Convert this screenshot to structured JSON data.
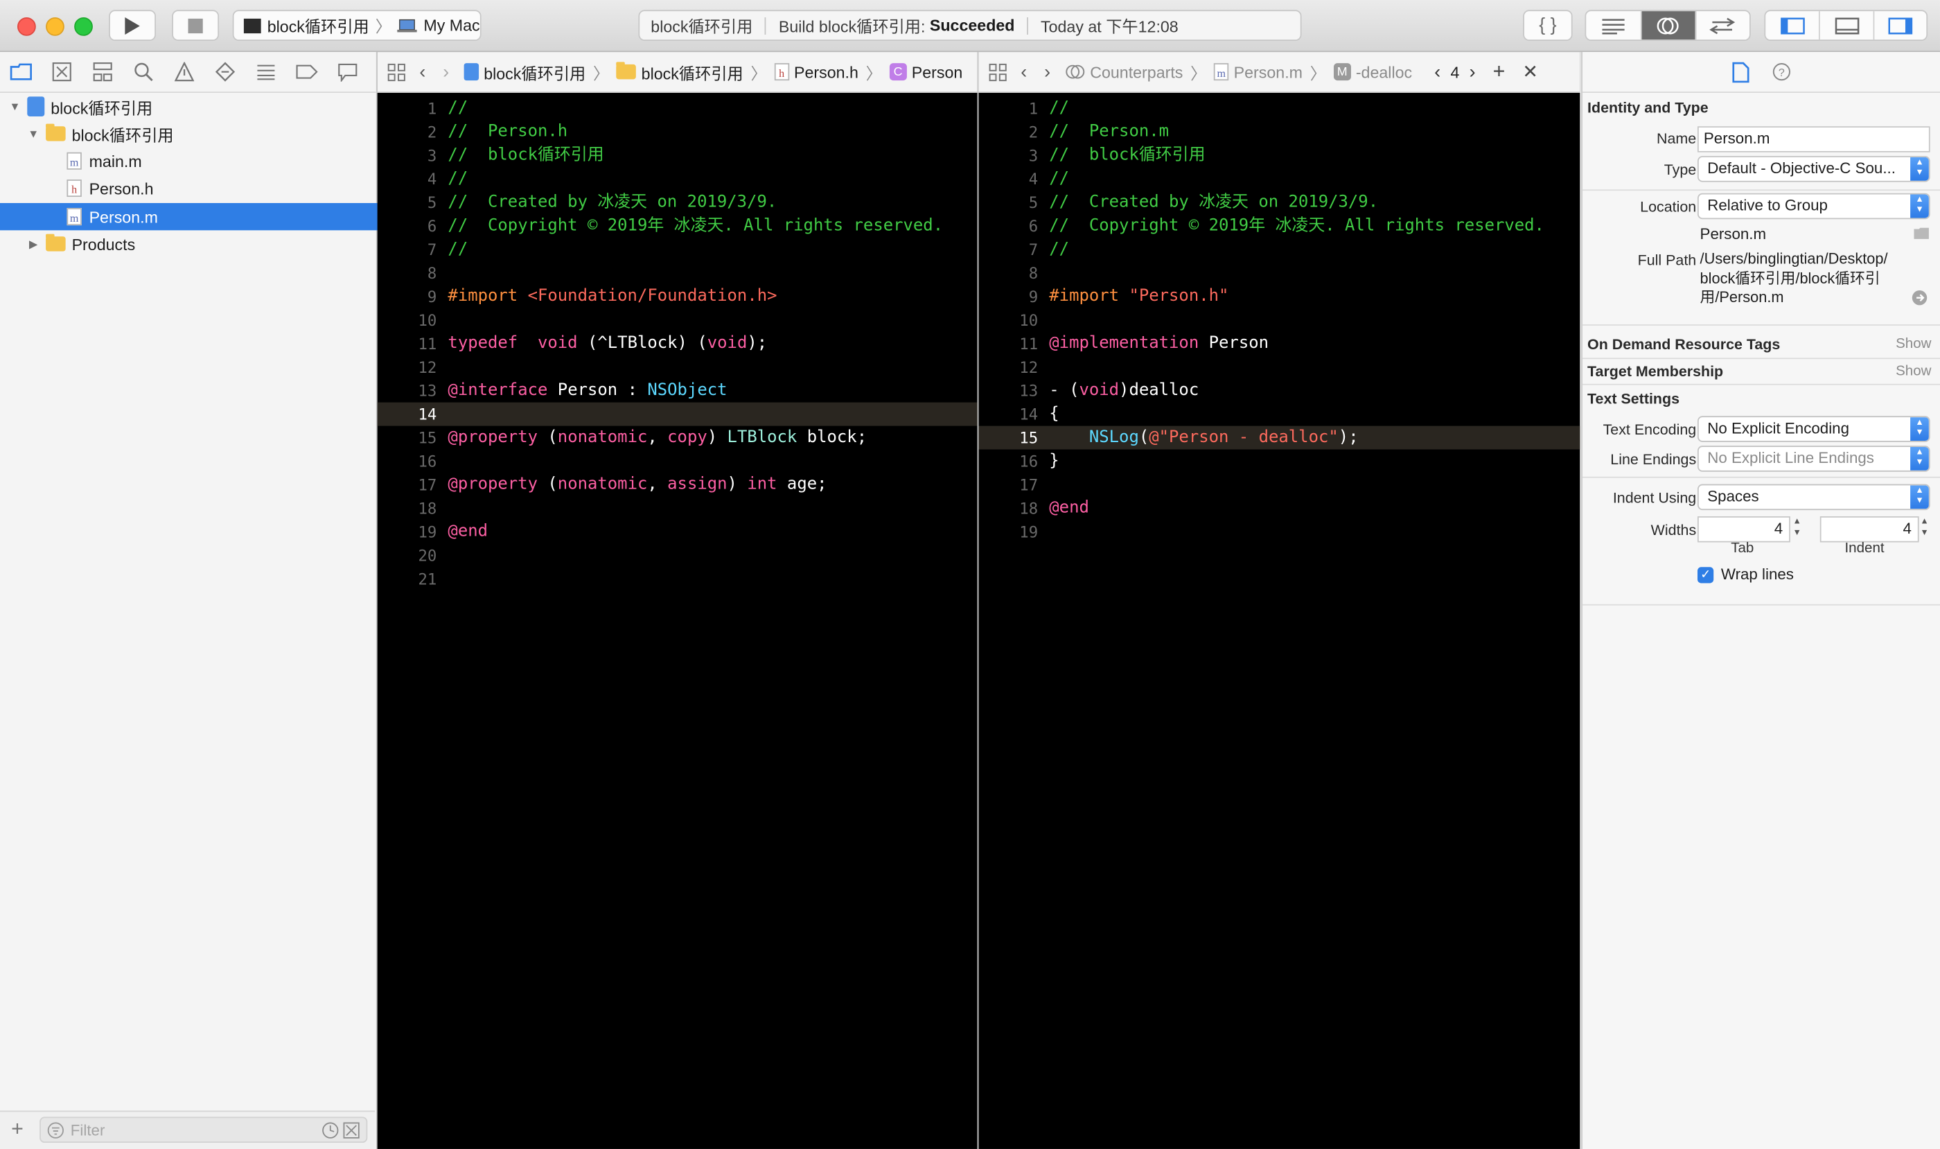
{
  "toolbar": {
    "scheme_name": "block循环引用",
    "destination": "My Mac",
    "status_project": "block循环引用",
    "status_build_prefix": "Build block循环引用:",
    "status_build_result": "Succeeded",
    "status_time": "Today at 下午12:08"
  },
  "navigator": {
    "items": [
      {
        "label": "block循环引用"
      },
      {
        "label": "block循环引用"
      },
      {
        "label": "main.m"
      },
      {
        "label": "Person.h"
      },
      {
        "label": "Person.m"
      },
      {
        "label": "Products"
      }
    ],
    "filter_placeholder": "Filter"
  },
  "left_editor": {
    "jumpbar": [
      "block循环引用",
      "block循环引用",
      "Person.h",
      "Person"
    ],
    "line_numbers": [
      "1",
      "2",
      "3",
      "4",
      "5",
      "6",
      "7",
      "8",
      "9",
      "10",
      "11",
      "12",
      "13",
      "14",
      "15",
      "16",
      "17",
      "18",
      "19",
      "20",
      "21"
    ]
  },
  "right_editor": {
    "jumpbar": [
      "Counterparts",
      "Person.m",
      "-dealloc"
    ],
    "counterpart_count": "4",
    "line_numbers": [
      "1",
      "2",
      "3",
      "4",
      "5",
      "6",
      "7",
      "8",
      "9",
      "10",
      "11",
      "12",
      "13",
      "14",
      "15",
      "16",
      "17",
      "18",
      "19"
    ]
  },
  "inspector": {
    "identity_title": "Identity and Type",
    "name_label": "Name",
    "name_value": "Person.m",
    "type_label": "Type",
    "type_value": "Default - Objective-C Sou...",
    "location_label": "Location",
    "location_value": "Relative to Group",
    "location_file": "Person.m",
    "fullpath_label": "Full Path",
    "fullpath_lines": [
      "/Users/binglingtian/Desktop/",
      "block循环引用/block循环引",
      "用/Person.m"
    ],
    "odr_title": "On Demand Resource Tags",
    "membership_title": "Target Membership",
    "show_label": "Show",
    "text_settings_title": "Text Settings",
    "encoding_label": "Text Encoding",
    "encoding_value": "No Explicit Encoding",
    "line_endings_label": "Line Endings",
    "line_endings_value": "No Explicit Line Endings",
    "indent_label": "Indent Using",
    "indent_value": "Spaces",
    "widths_label": "Widths",
    "tab_width": "4",
    "indent_width": "4",
    "tab_label": "Tab",
    "indent_caption": "Indent",
    "wrap_label": "Wrap lines"
  },
  "colors": {
    "selection": "#2f7ee5",
    "comment": "#41cc45",
    "keyword": "#fc5fa3",
    "string": "#fc6a5d"
  }
}
